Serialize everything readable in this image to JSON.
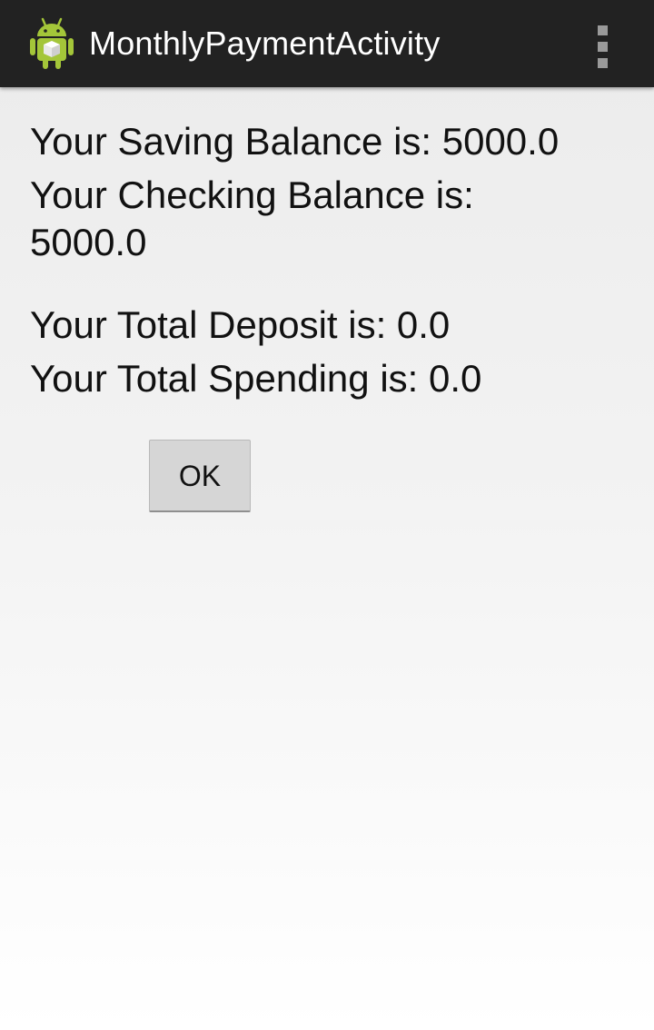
{
  "action_bar": {
    "title": "MonthlyPaymentActivity",
    "app_icon": "android-robot-icon",
    "overflow_icon": "overflow-menu-icon",
    "background": "#222222"
  },
  "balances": {
    "saving": "Your Saving Balance is: 5000.0",
    "checking": "Your Checking Balance is: 5000.0",
    "deposit": "Your Total Deposit is: 0.0",
    "spending": "Your Total Spending is: 0.0"
  },
  "buttons": {
    "ok_label": "OK"
  },
  "colors": {
    "text": "#111111",
    "button_bg": "#d6d6d6",
    "android_green": "#a4c639"
  }
}
